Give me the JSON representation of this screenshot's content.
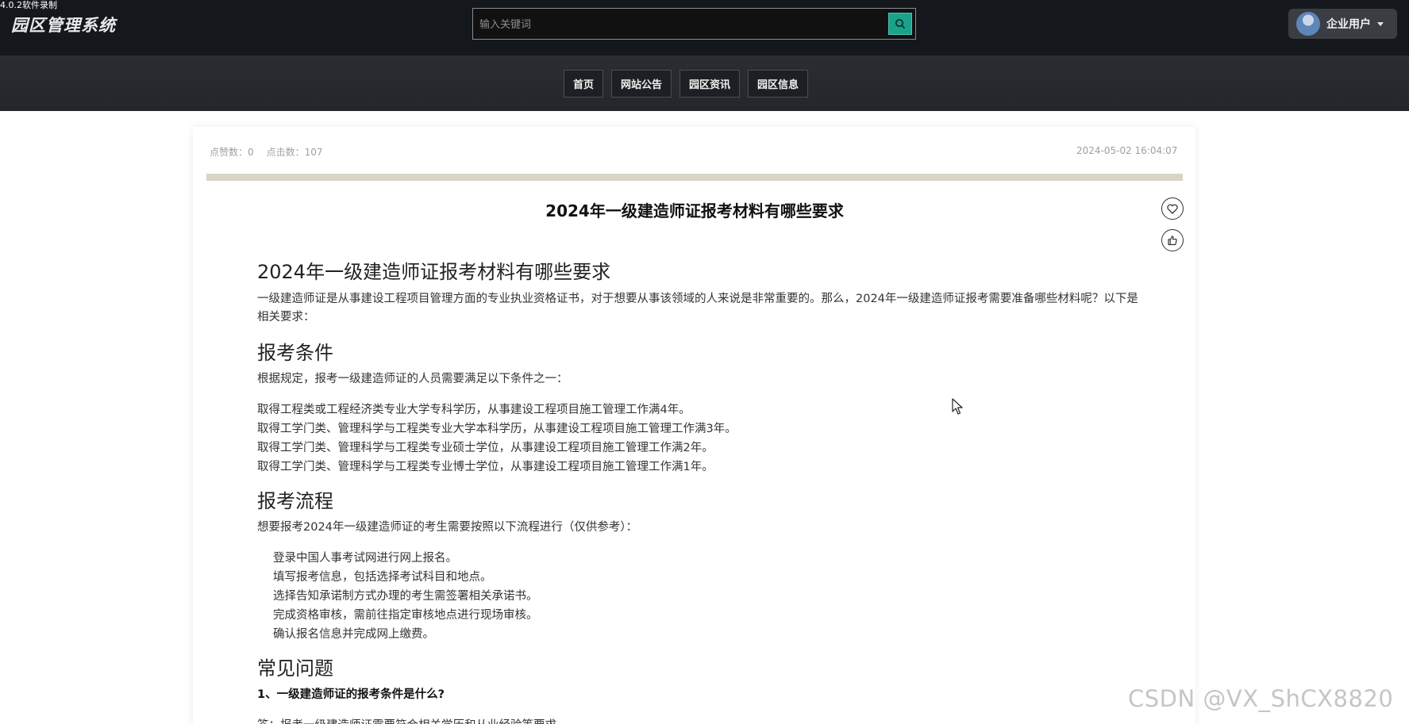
{
  "recorder": {
    "label": "4.0.2软件录制"
  },
  "header": {
    "logo": "园区管理系统",
    "search": {
      "placeholder": "输入关键词",
      "icon": "search-icon"
    },
    "user": {
      "name": "企业用户",
      "avatar_icon": "avatar-icon"
    }
  },
  "nav": {
    "items": [
      {
        "label": "首页"
      },
      {
        "label": "网站公告"
      },
      {
        "label": "园区资讯"
      },
      {
        "label": "园区信息"
      }
    ]
  },
  "article": {
    "likes_label": "点赞数：0",
    "clicks_label": "点击数：107",
    "timestamp": "2024-05-02 16:04:07",
    "title": "2024年一级建造师证报考材料有哪些要求",
    "actions": {
      "like_icon": "heart-icon",
      "thumb_icon": "thumbs-up-icon"
    },
    "body": {
      "h2": "2024年一级建造师证报考材料有哪些要求",
      "intro": "一级建造师证是从事建设工程项目管理方面的专业执业资格证书，对于想要从事该领域的人来说是非常重要的。那么，2024年一级建造师证报考需要准备哪些材料呢？以下是相关要求：",
      "section1_title": "报考条件",
      "section1_intro": "根据规定，报考一级建造师证的人员需要满足以下条件之一：",
      "conditions": [
        "取得工程类或工程经济类专业大学专科学历，从事建设工程项目施工管理工作满4年。",
        "取得工学门类、管理科学与工程类专业大学本科学历，从事建设工程项目施工管理工作满3年。",
        "取得工学门类、管理科学与工程类专业硕士学位，从事建设工程项目施工管理工作满2年。",
        "取得工学门类、管理科学与工程类专业博士学位，从事建设工程项目施工管理工作满1年。"
      ],
      "section2_title": "报考流程",
      "section2_intro": "想要报考2024年一级建造师证的考生需要按照以下流程进行（仅供参考）：",
      "steps": [
        "登录中国人事考试网进行网上报名。",
        "填写报考信息，包括选择考试科目和地点。",
        "选择告知承诺制方式办理的考生需签署相关承诺书。",
        "完成资格审核，需前往指定审核地点进行现场审核。",
        "确认报名信息并完成网上缴费。"
      ],
      "section3_title": "常见问题",
      "q1": "1、一级建造师证的报考条件是什么?",
      "cut_line": "答：报考一级建造师证需要符合相关学历和从业经验等要求。"
    }
  },
  "watermark": "CSDN @VX_ShCX8820",
  "colors": {
    "header_bg": "#14171c",
    "nav_bg": "#26292e",
    "search_btn": "#1aa38a",
    "divider": "#d9d5c5"
  }
}
